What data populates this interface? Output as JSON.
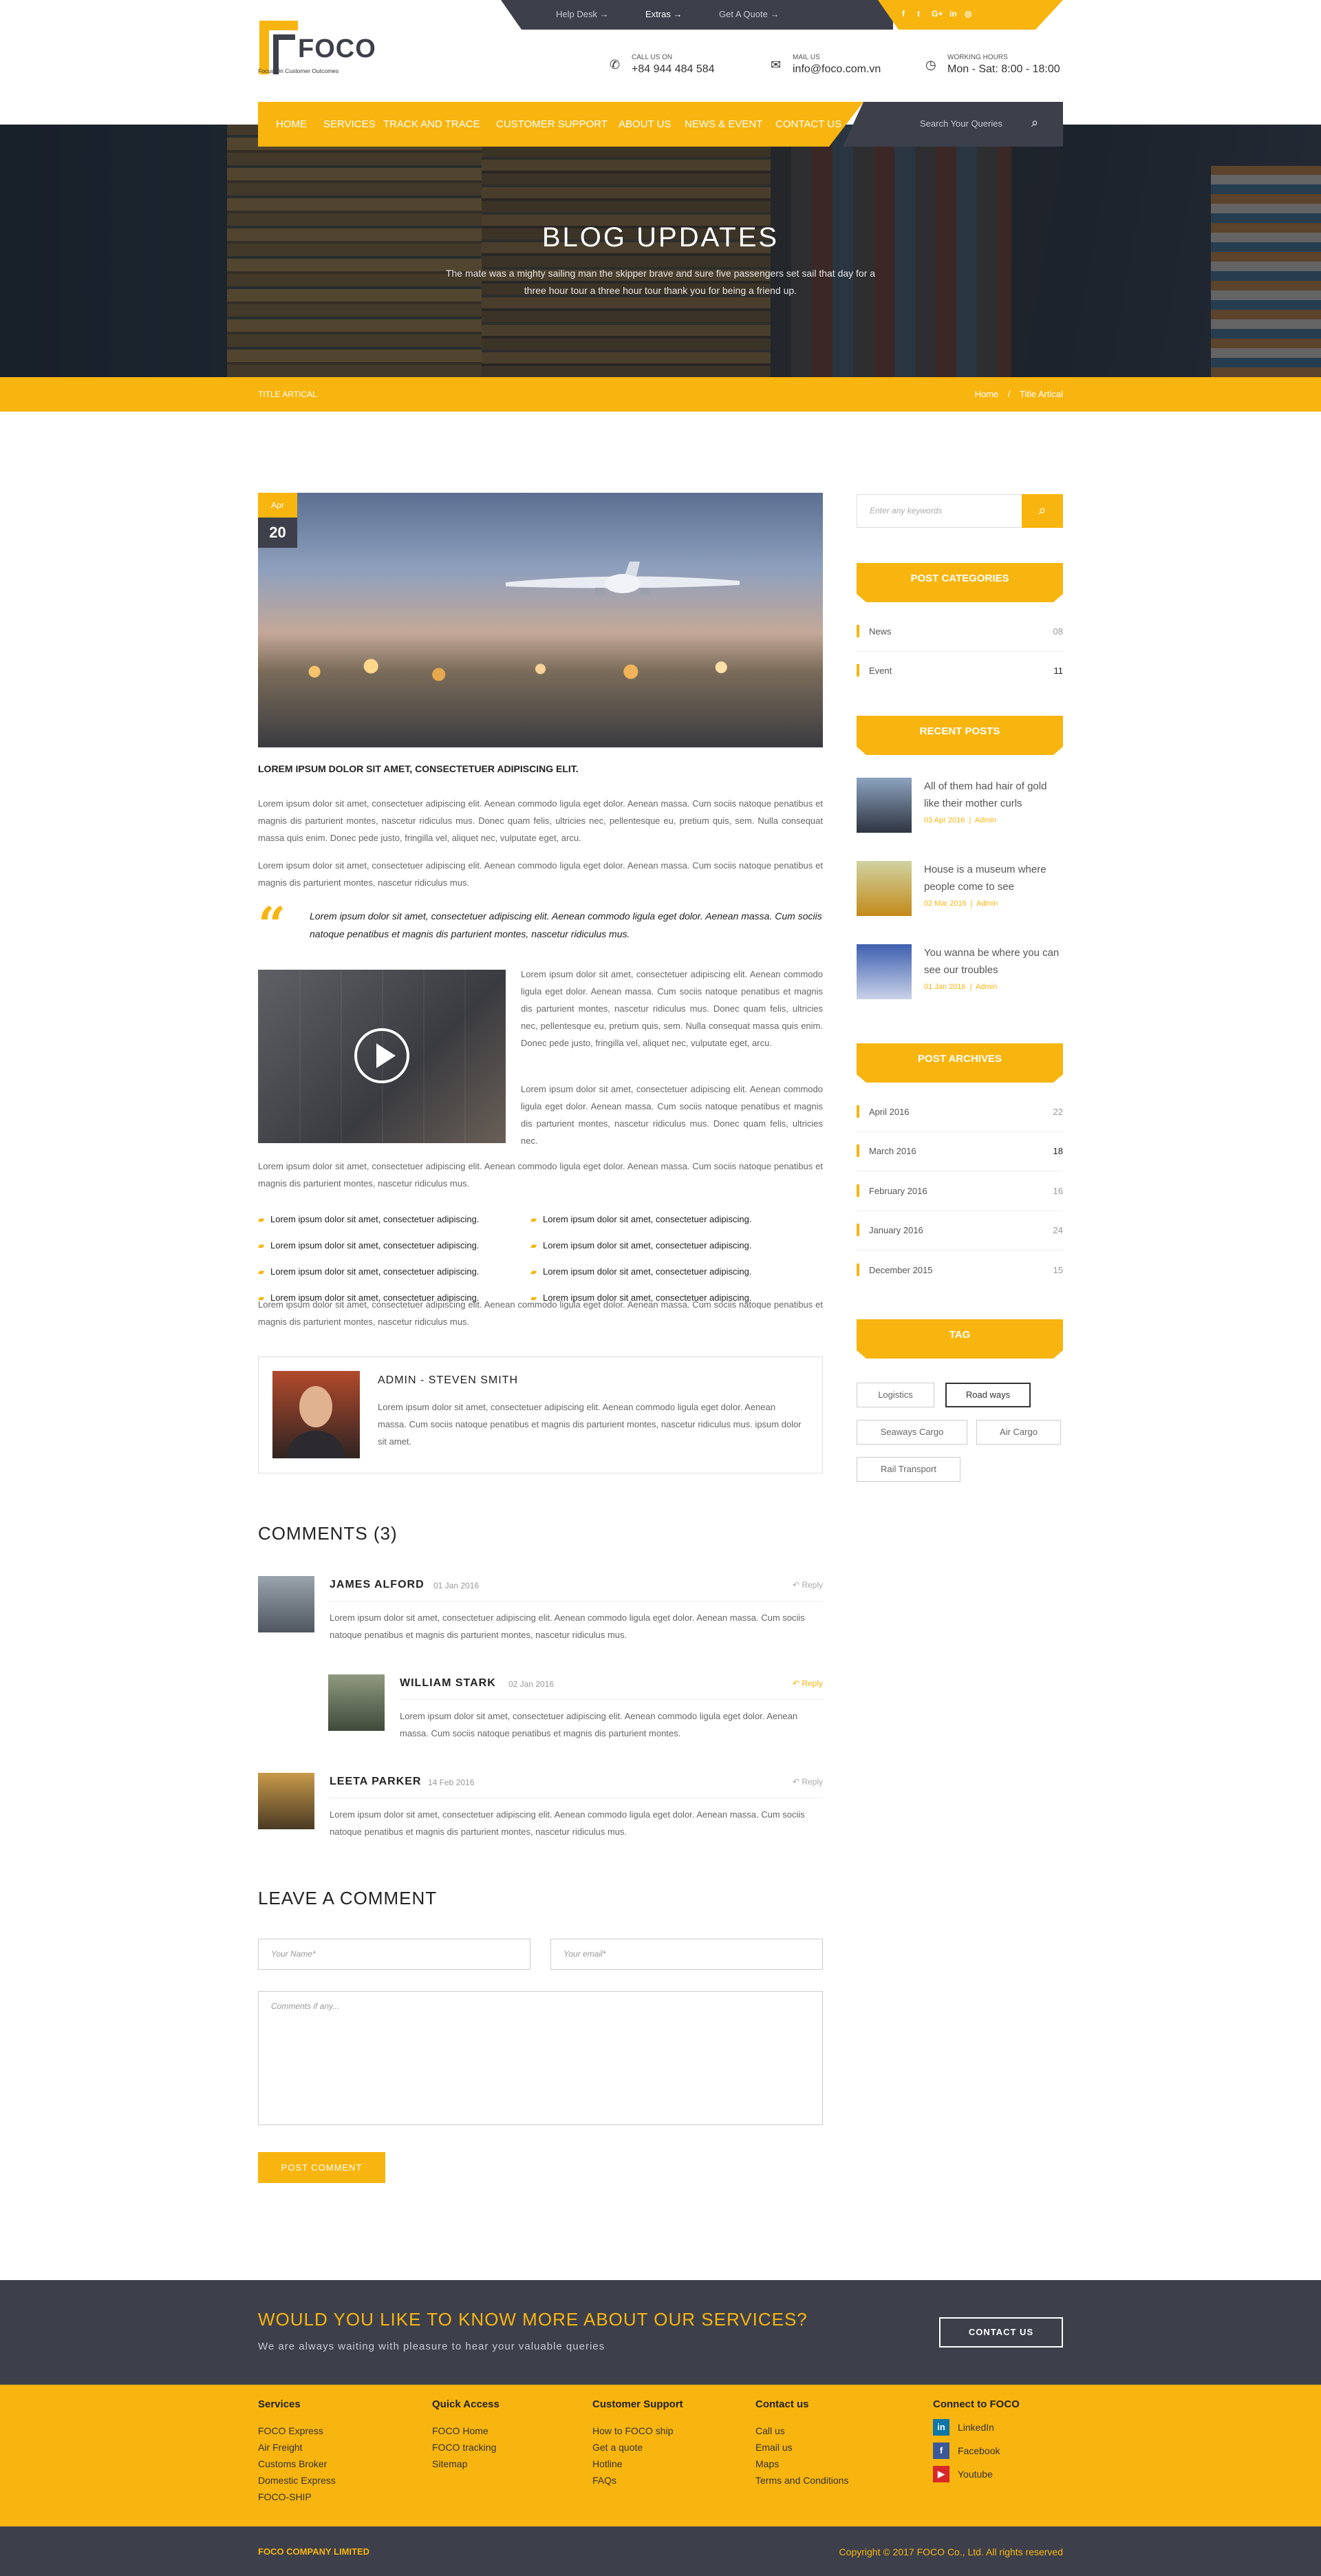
{
  "topbar": {
    "links": [
      "Help Desk →",
      "Extras →",
      "Get A Quote →"
    ],
    "social": [
      "f",
      "t",
      "G+",
      "in",
      "◎"
    ]
  },
  "logo": {
    "name": "FOCO",
    "tagline": "Focus On Customer Outcomes"
  },
  "contacts": [
    {
      "label": "Call us on",
      "value": "+84 944 484 584"
    },
    {
      "label": "Mail us",
      "value": "info@foco.com.vn"
    },
    {
      "label": "Working hours",
      "value": "Mon - Sat: 8:00 - 18:00"
    }
  ],
  "nav": {
    "items": [
      "HOME",
      "SERVICES",
      "TRACK AND TRACE",
      "CUSTOMER SUPPORT",
      "ABOUT US",
      "NEWS & EVENT",
      "CONTACT US"
    ],
    "search_placeholder": "Search Your Queries"
  },
  "hero": {
    "title": "BLOG UPDATES",
    "subtitle": "The mate was a mighty sailing man the skipper brave and sure five passengers set sail that day for a three hour tour a three hour tour thank you for being a friend up."
  },
  "breadcrumb": {
    "title": "TITLE ARTICAL",
    "home": "Home",
    "sep": "/",
    "current": "Title Artical"
  },
  "post": {
    "month": "Apr",
    "day": "20",
    "lead": "LOREM IPSUM DOLOR SIT AMET, CONSECTETUER ADIPISCING ELIT.",
    "p1": "Lorem ipsum dolor sit amet, consectetuer adipiscing elit. Aenean commodo ligula eget dolor. Aenean massa. Cum sociis natoque penatibus et magnis dis parturient montes, nascetur ridiculus mus. Donec quam felis, ultricies nec, pellentesque eu, pretium quis, sem. Nulla consequat massa quis enim. Donec pede justo, fringilla vel, aliquet nec, vulputate eget, arcu.",
    "p2": "Lorem ipsum dolor sit amet, consectetuer adipiscing elit. Aenean commodo ligula eget dolor. Aenean massa. Cum sociis natoque penatibus et magnis dis parturient montes, nascetur ridiculus mus.",
    "quote": "Lorem ipsum dolor sit amet, consectetuer adipiscing elit. Aenean commodo ligula eget dolor. Aenean massa. Cum sociis natoque penatibus et magnis dis parturient montes, nascetur ridiculus mus.",
    "v1": "Lorem ipsum dolor sit amet, consectetuer adipiscing elit. Aenean commodo ligula eget dolor. Aenean massa. Cum sociis natoque penatibus et magnis dis parturient montes, nascetur ridiculus mus. Donec quam felis, ultricies nec, pellentesque eu, pretium quis, sem. Nulla consequat massa quis enim. Donec pede justo, fringilla vel, aliquet nec, vulputate eget, arcu.",
    "v2": "Lorem ipsum dolor sit amet, consectetuer adipiscing elit. Aenean commodo ligula eget dolor. Aenean massa. Cum sociis natoque penatibus et magnis dis parturient montes, nascetur ridiculus mus. Donec quam felis, ultricies nec.",
    "p3": "Lorem ipsum dolor sit amet, consectetuer adipiscing elit. Aenean commodo ligula eget dolor. Aenean massa. Cum sociis natoque penatibus et magnis dis parturient montes, nascetur ridiculus mus.",
    "list": [
      "Lorem ipsum dolor sit amet, consectetuer adipiscing.",
      "Lorem ipsum dolor sit amet, consectetuer adipiscing.",
      "Lorem ipsum dolor sit amet, consectetuer adipiscing.",
      "Lorem ipsum dolor sit amet, consectetuer adipiscing.",
      "Lorem ipsum dolor sit amet, consectetuer adipiscing.",
      "Lorem ipsum dolor sit amet, consectetuer adipiscing.",
      "Lorem ipsum dolor sit amet, consectetuer adipiscing.",
      "Lorem ipsum dolor sit amet, consectetuer adipiscing."
    ],
    "p4": "Lorem ipsum dolor sit amet, consectetuer adipiscing elit. Aenean commodo ligula eget dolor. Aenean massa. Cum sociis natoque penatibus et magnis dis parturient montes, nascetur ridiculus mus."
  },
  "author": {
    "name": "ADMIN - STEVEN SMITH",
    "bio": "Lorem ipsum dolor sit amet, consectetuer adipiscing elit. Aenean commodo ligula eget dolor. Aenean massa. Cum sociis natoque penatibus et magnis dis parturient montes, nascetur ridiculus mus. ipsum dolor sit amet."
  },
  "comments": {
    "heading": "COMMENTS (3)",
    "reply": "Reply",
    "items": [
      {
        "name": "JAMES ALFORD",
        "date": "01 Jan 2016",
        "text": "Lorem ipsum dolor sit amet, consectetuer adipiscing elit. Aenean commodo ligula eget dolor. Aenean massa. Cum sociis natoque penatibus et magnis dis parturient montes, nascetur ridiculus mus."
      },
      {
        "name": "WILLIAM STARK",
        "date": "02 Jan 2016",
        "text": "Lorem ipsum dolor sit amet, consectetuer adipiscing elit. Aenean commodo ligula eget dolor. Aenean massa. Cum sociis natoque penatibus et magnis dis parturient montes."
      },
      {
        "name": "LEETA PARKER",
        "date": "14 Feb 2016",
        "text": "Lorem ipsum dolor sit amet, consectetuer adipiscing elit. Aenean commodo ligula eget dolor. Aenean massa. Cum sociis natoque penatibus et magnis dis parturient montes, nascetur ridiculus mus."
      }
    ]
  },
  "form": {
    "heading": "LEAVE A COMMENT",
    "name_placeholder": "Your Name*",
    "email_placeholder": "Your email*",
    "comment_placeholder": "Comments if any...",
    "submit": "POST COMMENT"
  },
  "sidebar": {
    "search_placeholder": "Enter any keywords",
    "categories_title": "POST CATEGORIES",
    "categories": [
      {
        "name": "News",
        "count": "08"
      },
      {
        "name": "Event",
        "count": "11"
      }
    ],
    "recent_title": "RECENT POSTS",
    "recent": [
      {
        "title": "All of them had hair of gold like their mother curls",
        "date": "03 Apr 2016",
        "author": "Admin"
      },
      {
        "title": "House is a museum where people come to see",
        "date": "02 Mar 2016",
        "author": "Admin"
      },
      {
        "title": "You wanna be where you can see our troubles",
        "date": "01 Jan 2016",
        "author": "Admin"
      }
    ],
    "archives_title": "POST ARCHIVES",
    "archives": [
      {
        "name": "April 2016",
        "count": "22"
      },
      {
        "name": "March 2016",
        "count": "18"
      },
      {
        "name": "February 2016",
        "count": "16"
      },
      {
        "name": "January 2016",
        "count": "24"
      },
      {
        "name": "December 2015",
        "count": "15"
      }
    ],
    "tag_title": "TAG",
    "tags": [
      "Logistics",
      "Road ways",
      "Seaways Cargo",
      "Air Cargo",
      "Rail Transport"
    ]
  },
  "cta": {
    "heading": "WOULD YOU LIKE TO KNOW MORE ABOUT OUR SERVICES?",
    "sub": "We are always waiting with pleasure to hear your valuable queries",
    "button": "CONTACT US"
  },
  "footer": {
    "cols": [
      {
        "title": "Services",
        "links": [
          "FOCO Express",
          "Air Freight",
          "Customs Broker",
          "Domestic Express",
          "FOCO-SHIP"
        ]
      },
      {
        "title": "Quick Access",
        "links": [
          "FOCO Home",
          "FOCO tracking",
          "Sitemap"
        ]
      },
      {
        "title": "Customer Support",
        "links": [
          "How to FOCO ship",
          "Get a quote",
          "Hotline",
          "FAQs"
        ]
      },
      {
        "title": "Contact us",
        "links": [
          "Call us",
          "Email us",
          "Maps",
          "Terms and Conditions"
        ]
      }
    ],
    "connect_title": "Connect to FOCO",
    "connect": [
      "LinkedIn",
      "Facebook",
      "Youtube"
    ]
  },
  "copyright": {
    "left": "FOCO COMPANY LIMITED",
    "right": "Copyright © 2017 FOCO Co., Ltd. All rights reserved"
  },
  "colors": {
    "accent": "#f8b50f",
    "dark": "#3d404b"
  }
}
